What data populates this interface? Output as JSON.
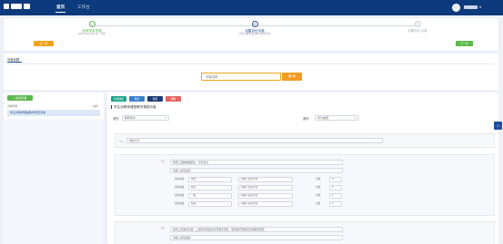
{
  "nav": {
    "home": "首页",
    "workbench": "工作台"
  },
  "steps": [
    {
      "num": "✓",
      "title": "选择学年学期",
      "sub": "(2023-2024学年 第一学期)"
    },
    {
      "num": "2",
      "title": "设置评价问卷",
      "sub": "(学生对教师课堂教学调查问卷)"
    },
    {
      "num": "3",
      "title": "设置评价对象",
      "sub": ""
    }
  ],
  "steps_buttons": {
    "prev": "上一步",
    "next": "下一步"
  },
  "search": {
    "tab": "问卷标题",
    "placeholder": "问卷名称",
    "button": "搜 索"
  },
  "left": {
    "add_button": "+ 新建问卷",
    "list_header_left": "问卷标题",
    "list_header_right": "操作 ↓",
    "items": [
      "学生对教师课堂教学调查问卷"
    ]
  },
  "toolbar": [
    "新增题目",
    "预览",
    "保存",
    "删除"
  ],
  "survey": {
    "title": "学生对教师课堂教学调查问卷",
    "type_label": "类别",
    "type_value": "教师评价",
    "type_label2": "类别",
    "type_value2": "评分类题"
  },
  "section1": {
    "num": "一、",
    "value": "课堂行为"
  },
  "question1": {
    "num": "*1.",
    "title": "教师上课精神面貌好、声音洪亮",
    "desc": "请输入题目描述",
    "options": [
      {
        "label": "选项内容",
        "value": "非常",
        "score_ph": "请输入选项分值",
        "score_label": "分值",
        "score": "8"
      },
      {
        "label": "选项内容",
        "value": "较好",
        "score_ph": "请输入选项分值",
        "score_label": "分值",
        "score": "6"
      },
      {
        "label": "选项内容",
        "value": "一般",
        "score_ph": "请输入选项分值",
        "score_label": "分值",
        "score": "4"
      },
      {
        "label": "选项内容",
        "value": "较差",
        "score_ph": "请输入选项分值",
        "score_label": "分值",
        "score": "2"
      }
    ]
  },
  "question2": {
    "num": "*2.",
    "title": "教师上课准时到课，上课期间无随意离开教室现象，能够遵守课堂纪律和教学规范",
    "desc": "请输入题目描述"
  },
  "colors": {
    "nav_bg": "#0d3a7c",
    "accent_orange": "#f29a24",
    "accent_green": "#5db84c",
    "accent_teal": "#1aa38a",
    "accent_red": "#e46363"
  }
}
